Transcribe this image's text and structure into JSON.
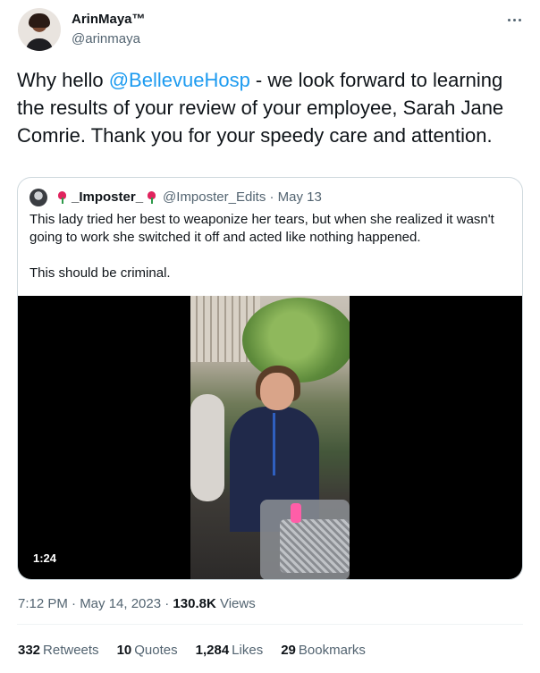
{
  "author": {
    "display_name": "ArinMaya™",
    "handle": "@arinmaya"
  },
  "tweet": {
    "text_before": "Why hello ",
    "mention": "@BellevueHosp",
    "text_after": " - we look forward to learning the results of your review of your employee, Sarah Jane Comrie. Thank you for your speedy care and attention."
  },
  "quoted": {
    "name": "_Imposter_",
    "handle": "@Imposter_Edits",
    "date": "· May 13",
    "text_1": "This lady tried her best to weaponize her tears, but when she realized it wasn't going to work she switched it off and acted like nothing happened.",
    "text_2": "This should be criminal.",
    "video": {
      "duration": "1:24"
    }
  },
  "meta": {
    "time_date": "7:12 PM · May 14, 2023 · ",
    "views_count": "130.8K",
    "views_label": " Views"
  },
  "stats": {
    "retweets_count": "332",
    "retweets_label": "Retweets",
    "quotes_count": "10",
    "quotes_label": "Quotes",
    "likes_count": "1,284",
    "likes_label": "Likes",
    "bookmarks_count": "29",
    "bookmarks_label": "Bookmarks"
  },
  "colors": {
    "link": "#1d9bf0",
    "text_primary": "#0f1419",
    "text_secondary": "#536471",
    "border": "#cfd9de"
  }
}
